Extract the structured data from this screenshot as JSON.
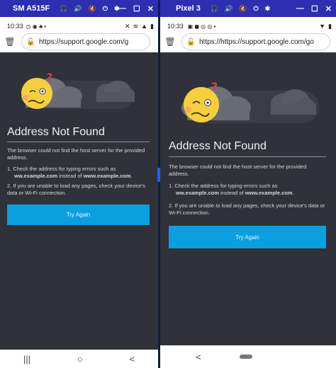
{
  "left": {
    "window_title": "SM A515F",
    "status_time": "10:33",
    "url": "https://support.google.com/g",
    "page": {
      "heading": "Address Not Found",
      "description": "The browser could not find the host server for the provided address.",
      "item1_prefix": "1. Check the address for typing errors such as",
      "item1_ex1": "ww.example.com",
      "item1_mid": " instead of ",
      "item1_ex2": "www.example.com",
      "item1_end": ".",
      "item2": "2. If you are unable to load any pages, check your device's data or Wi-Fi connection.",
      "button": "Try Again"
    },
    "nav": {
      "recents": "|||",
      "home": "○",
      "back": "<"
    }
  },
  "right": {
    "window_title": "Pixel 3",
    "status_time": "10:33",
    "url": "https://https://support.google.com/go",
    "page": {
      "heading": "Address Not Found",
      "description": "The browser could not find the host server for the provided address.",
      "item1_prefix": "1. Check the address for typing errors such as",
      "item1_ex1": "ww.example.com",
      "item1_mid": " instead of ",
      "item1_ex2": "www.example.com",
      "item1_end": ".",
      "item2": "2. If you are unable to load any pages, check your device's data or Wi-Fi connection.",
      "button": "Try Again"
    },
    "nav": {
      "back": "<"
    }
  },
  "colors": {
    "titlebar": "#2b2fb0",
    "content_bg": "#2f3238",
    "button": "#0aa0df",
    "desktop": "#0e1f3f"
  }
}
